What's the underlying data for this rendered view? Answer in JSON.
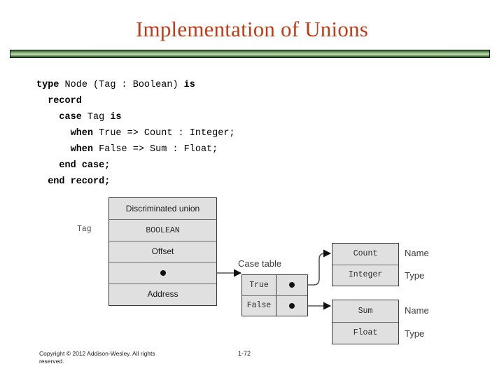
{
  "slide": {
    "title": "Implementation of Unions",
    "title_color": "#C33A16",
    "rule_color": "#4e7c45"
  },
  "code": {
    "lines": [
      [
        {
          "t": "type ",
          "b": true
        },
        {
          "t": "Node (Tag : Boolean) ",
          "b": false
        },
        {
          "t": "is",
          "b": true
        }
      ],
      [
        {
          "t": "  record",
          "b": true
        }
      ],
      [
        {
          "t": "    case ",
          "b": true
        },
        {
          "t": "Tag ",
          "b": false
        },
        {
          "t": "is",
          "b": true
        }
      ],
      [
        {
          "t": "      when ",
          "b": true
        },
        {
          "t": "True => Count : Integer;",
          "b": false
        }
      ],
      [
        {
          "t": "      when ",
          "b": true
        },
        {
          "t": "False => Sum : Float;",
          "b": false
        }
      ],
      [
        {
          "t": "    end case;",
          "b": true
        }
      ],
      [
        {
          "t": "  end record;",
          "b": true
        }
      ]
    ]
  },
  "diagram": {
    "union_table": {
      "label": "Tag",
      "rows": [
        {
          "text": "Discriminated union",
          "kind": "text"
        },
        {
          "text": "BOOLEAN",
          "kind": "mono"
        },
        {
          "text": "Offset",
          "kind": "text"
        },
        {
          "text": "",
          "kind": "dot"
        },
        {
          "text": "Address",
          "kind": "text"
        }
      ]
    },
    "case_table": {
      "label": "Case table",
      "rows": [
        {
          "text": "True",
          "pointer": true
        },
        {
          "text": "False",
          "pointer": true
        }
      ]
    },
    "count_table": {
      "rows": [
        {
          "text": "Count",
          "annotation": "Name"
        },
        {
          "text": "Integer",
          "annotation": "Type"
        }
      ]
    },
    "sum_table": {
      "rows": [
        {
          "text": "Sum",
          "annotation": "Name"
        },
        {
          "text": "Float",
          "annotation": "Type"
        }
      ]
    }
  },
  "footer": {
    "copyright": "Copyright © 2012 Addison-Wesley. All rights reserved.",
    "page": "1-72"
  }
}
